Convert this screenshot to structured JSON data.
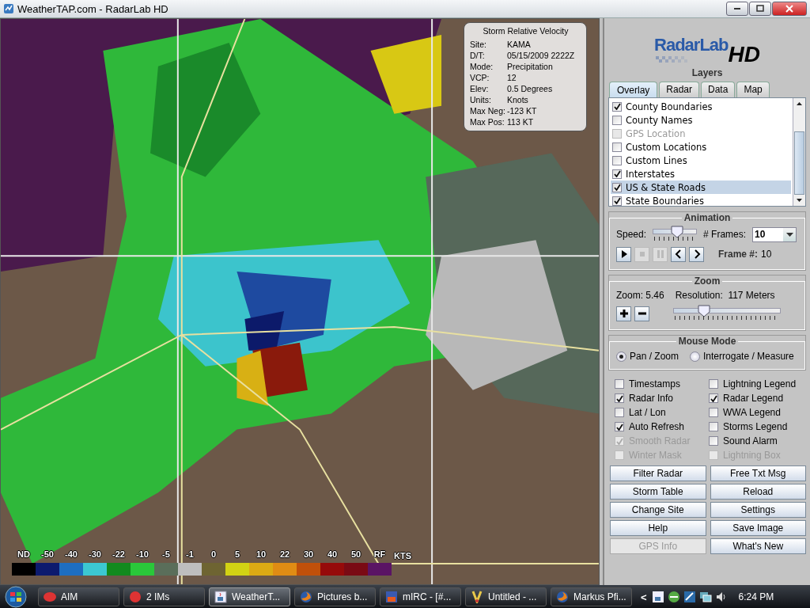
{
  "window": {
    "title": "WeatherTAP.com - RadarLab HD"
  },
  "radar_info": {
    "title": "Storm Relative Velocity",
    "rows": [
      {
        "label": "Site:",
        "value": "KAMA"
      },
      {
        "label": "D/T:",
        "value": "05/15/2009 2222Z"
      },
      {
        "label": "Mode:",
        "value": "Precipitation"
      },
      {
        "label": "VCP:",
        "value": "12"
      },
      {
        "label": "Elev:",
        "value": "0.5 Degrees"
      },
      {
        "label": "Units:",
        "value": "Knots"
      },
      {
        "label": "Max Neg:",
        "value": "-123 KT"
      },
      {
        "label": "Max Pos:",
        "value": "113 KT"
      }
    ]
  },
  "legend": {
    "unit": "KTS",
    "items": [
      {
        "label": "ND",
        "color": "#000000"
      },
      {
        "label": "-50",
        "color": "#0c1a6e"
      },
      {
        "label": "-40",
        "color": "#1e6ec0"
      },
      {
        "label": "-30",
        "color": "#3cc8d2"
      },
      {
        "label": "-22",
        "color": "#128a1e"
      },
      {
        "label": "-10",
        "color": "#2ac83a"
      },
      {
        "label": "-5",
        "color": "#5a6e5a"
      },
      {
        "label": "-1",
        "color": "#bebebe"
      },
      {
        "label": "0",
        "color": "#6e6432"
      },
      {
        "label": "5",
        "color": "#d2d214"
      },
      {
        "label": "10",
        "color": "#dcaa14"
      },
      {
        "label": "22",
        "color": "#e08c14"
      },
      {
        "label": "30",
        "color": "#c0500a"
      },
      {
        "label": "40",
        "color": "#960a0a"
      },
      {
        "label": "50",
        "color": "#7a0a14"
      },
      {
        "label": "RF",
        "color": "#5a1464"
      }
    ]
  },
  "panel": {
    "logo": {
      "name": "RadarLab",
      "suffix": "HD"
    },
    "layers_title": "Layers",
    "tabs": [
      {
        "label": "Overlay",
        "selected": true
      },
      {
        "label": "Radar",
        "selected": false
      },
      {
        "label": "Data",
        "selected": false
      },
      {
        "label": "Map",
        "selected": false
      }
    ],
    "overlay_items": [
      {
        "label": "County Boundaries",
        "checked": true,
        "disabled": false,
        "selected": false
      },
      {
        "label": "County Names",
        "checked": false,
        "disabled": false,
        "selected": false
      },
      {
        "label": "GPS Location",
        "checked": false,
        "disabled": true,
        "selected": false
      },
      {
        "label": "Custom Locations",
        "checked": false,
        "disabled": false,
        "selected": false
      },
      {
        "label": "Custom Lines",
        "checked": false,
        "disabled": false,
        "selected": false
      },
      {
        "label": "Interstates",
        "checked": true,
        "disabled": false,
        "selected": false
      },
      {
        "label": "US & State Roads",
        "checked": true,
        "disabled": false,
        "selected": true
      },
      {
        "label": "State Boundaries",
        "checked": true,
        "disabled": false,
        "selected": false
      }
    ],
    "animation": {
      "title": "Animation",
      "speed_label": "Speed:",
      "speed": {
        "level": 0.55
      },
      "frames_label": "# Frames:",
      "frames_value": "10",
      "controls": [
        {
          "kind": "play",
          "disabled": false
        },
        {
          "kind": "stop",
          "disabled": true
        },
        {
          "kind": "pause",
          "disabled": true
        },
        {
          "kind": "prev",
          "disabled": false
        },
        {
          "kind": "next",
          "disabled": false
        }
      ],
      "frame_label": "Frame #:",
      "frame_value": "10"
    },
    "zoom": {
      "title": "Zoom",
      "zoom_label": "Zoom:",
      "zoom_value": "5.46",
      "resolution_label": "Resolution:",
      "resolution_value": "117 Meters",
      "slider": {
        "level": 0.29
      },
      "buttons": [
        {
          "kind": "plus"
        },
        {
          "kind": "minus"
        }
      ]
    },
    "mouse_mode": {
      "title": "Mouse Mode",
      "options": [
        {
          "label": "Pan / Zoom",
          "selected": true
        },
        {
          "label": "Interrogate / Measure",
          "selected": false
        }
      ]
    },
    "options": [
      {
        "label": "Timestamps",
        "checked": false,
        "disabled": false
      },
      {
        "label": "Lightning Legend",
        "checked": false,
        "disabled": false
      },
      {
        "label": "Radar Info",
        "checked": true,
        "disabled": false
      },
      {
        "label": "Radar Legend",
        "checked": true,
        "disabled": false
      },
      {
        "label": "Lat / Lon",
        "checked": false,
        "disabled": false
      },
      {
        "label": "WWA Legend",
        "checked": false,
        "disabled": false
      },
      {
        "label": "Auto Refresh",
        "checked": true,
        "disabled": false
      },
      {
        "label": "Storms Legend",
        "checked": false,
        "disabled": false
      },
      {
        "label": "Smooth Radar",
        "checked": true,
        "disabled": true
      },
      {
        "label": "Sound Alarm",
        "checked": false,
        "disabled": false
      },
      {
        "label": "Winter Mask",
        "checked": false,
        "disabled": true
      },
      {
        "label": "Lightning Box",
        "checked": false,
        "disabled": true
      }
    ],
    "buttons": [
      {
        "label": "Filter Radar",
        "disabled": false
      },
      {
        "label": "Free Txt Msg",
        "disabled": false
      },
      {
        "label": "Storm Table",
        "disabled": false
      },
      {
        "label": "Reload",
        "disabled": false
      },
      {
        "label": "Change Site",
        "disabled": false
      },
      {
        "label": "Settings",
        "disabled": false
      },
      {
        "label": "Help",
        "disabled": false
      },
      {
        "label": "Save Image",
        "disabled": false
      },
      {
        "label": "GPS Info",
        "disabled": true
      },
      {
        "label": "What's New",
        "disabled": false
      }
    ]
  },
  "taskbar": {
    "items": [
      {
        "label": "AIM",
        "selected": false
      },
      {
        "label": "2 IMs",
        "selected": false
      },
      {
        "label": "WeatherT...",
        "selected": true
      },
      {
        "label": "Pictures b...",
        "selected": false
      },
      {
        "label": "mIRC - [#...",
        "selected": false
      },
      {
        "label": "Untitled - ...",
        "selected": false
      },
      {
        "label": "Markus Pfi...",
        "selected": false
      }
    ],
    "tray_toggle": "<",
    "clock": "6:24 PM"
  }
}
